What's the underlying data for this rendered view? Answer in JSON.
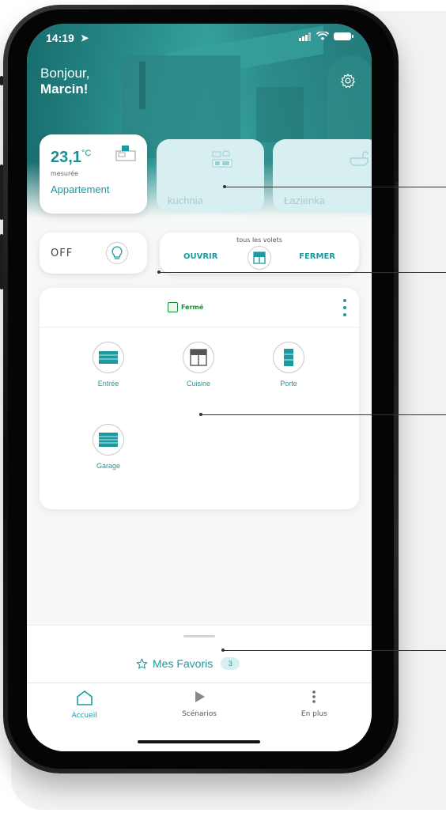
{
  "status_bar": {
    "time": "14:19"
  },
  "header": {
    "greeting": "Bonjour,",
    "user_name": "Marcin!"
  },
  "rooms": [
    {
      "temperature": "23,1",
      "unit": "°C",
      "sublabel": "mesurée",
      "name": "Appartement",
      "icon": "tv-icon"
    },
    {
      "name": "kuchnia",
      "icon": "kitchen-icon"
    },
    {
      "name": "Łazienka",
      "icon": "bathtub-icon"
    }
  ],
  "light_switch": {
    "state": "OFF",
    "icon": "lightbulb-icon"
  },
  "shutters": {
    "title": "tous les volets",
    "open_label": "OUVRIR",
    "close_label": "FERMER",
    "icon": "shutter-icon"
  },
  "device_group": {
    "status": "Fermé",
    "status_color": "#1a8a3b",
    "devices": [
      {
        "label": "Entrée",
        "icon": "gate-icon"
      },
      {
        "label": "Cuisine",
        "icon": "window-icon"
      },
      {
        "label": "Porte",
        "icon": "door-icon"
      },
      {
        "label": "Garage",
        "icon": "garage-door-icon"
      }
    ]
  },
  "favorites": {
    "label": "Mes Favoris",
    "count": "3",
    "icon": "star-icon"
  },
  "tab_bar": [
    {
      "label": "Accueil",
      "icon": "home-icon",
      "active": true
    },
    {
      "label": "Scénarios",
      "icon": "play-icon",
      "active": false
    },
    {
      "label": "En plus",
      "icon": "more-vertical-icon",
      "active": false
    }
  ],
  "colors": {
    "accent": "#1b9aa0",
    "hero": "#2a8f8d",
    "room_inactive": "#d8eff2",
    "status_green": "#1a8a3b"
  }
}
